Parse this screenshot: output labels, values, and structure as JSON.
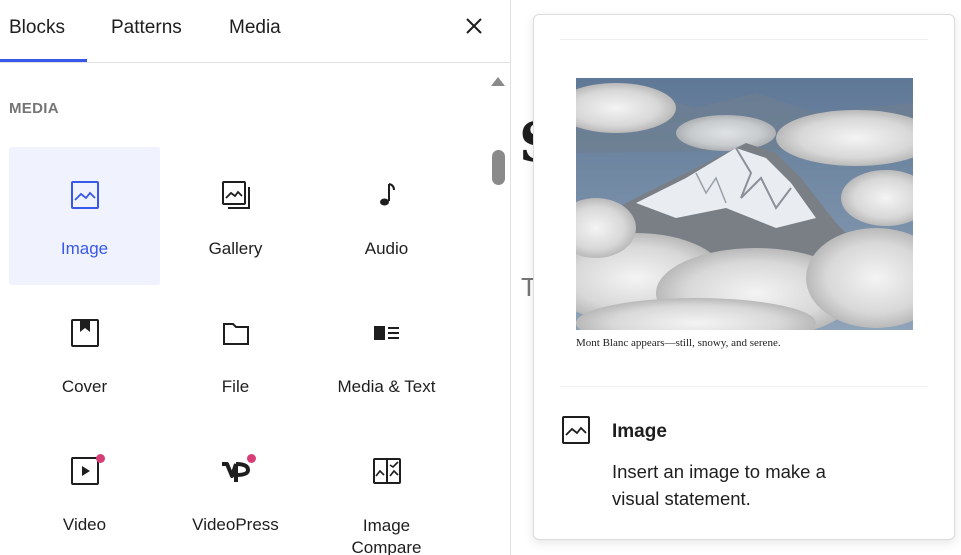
{
  "tabs": [
    {
      "label": "Blocks",
      "active": true
    },
    {
      "label": "Patterns",
      "active": false
    },
    {
      "label": "Media",
      "active": false
    }
  ],
  "section_title": "MEDIA",
  "blocks": [
    {
      "label": "Image",
      "icon": "image-icon",
      "selected": true
    },
    {
      "label": "Gallery",
      "icon": "gallery-icon"
    },
    {
      "label": "Audio",
      "icon": "audio-icon"
    },
    {
      "label": "Cover",
      "icon": "cover-icon"
    },
    {
      "label": "File",
      "icon": "file-icon"
    },
    {
      "label": "Media & Text",
      "icon": "media-text-icon"
    },
    {
      "label": "Video",
      "icon": "video-icon",
      "new_badge": true
    },
    {
      "label": "VideoPress",
      "icon": "videopress-icon",
      "new_badge": true
    },
    {
      "label": "Image\nCompare",
      "icon": "image-compare-icon"
    }
  ],
  "editor_peek": {
    "heading_char": "S",
    "text_char": "T"
  },
  "preview": {
    "caption": "Mont Blanc appears—still, snowy, and serene.",
    "title": "Image",
    "description": "Insert an image to make a visual statement."
  },
  "colors": {
    "accent": "#3858e9",
    "selected_bg": "#f0f3fd",
    "badge": "#d63e77",
    "muted": "#757575"
  }
}
